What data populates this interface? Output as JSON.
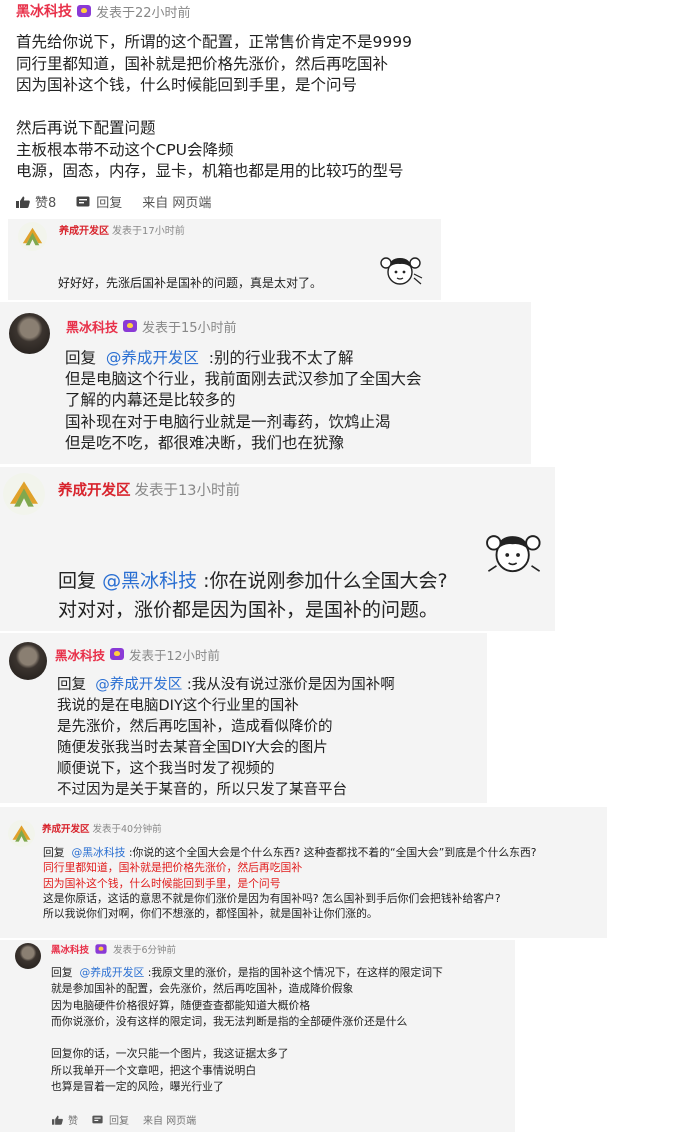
{
  "top_post": {
    "author": "黑冰科技",
    "time": "发表于22小时前",
    "lines": [
      "首先给你说下，所谓的这个配置，正常售价肯定不是9999",
      "同行里都知道，国补就是把价格先涨价，然后再吃国补",
      "因为国补这个钱，什么时候能回到手里，是个问号",
      "",
      "然后再说下配置问题",
      "主板根本带不动这个CPU会降频",
      "电源，固态，内存，显卡，机箱也都是用的比较巧的型号"
    ],
    "actions": {
      "like": "赞8",
      "reply": "回复",
      "source": "来自 网页端"
    }
  },
  "replies": [
    {
      "author": "养成开发区",
      "time": "发表于17小时前",
      "lines": [
        "好好好，先涨后国补是国补的问题，真是太对了。"
      ]
    },
    {
      "author": "黑冰科技",
      "time": "发表于15小时前",
      "reply_prefix": "回复",
      "mention": "@养成开发区",
      "first_rest": ":别的行业我不太了解",
      "lines": [
        "但是电脑这个行业，我前面刚去武汉参加了全国大会",
        "了解的内幕还是比较多的",
        "国补现在对于电脑行业就是一剂毒药，饮鸩止渴",
        "但是吃不吃，都很难决断，我们也在犹豫"
      ]
    },
    {
      "author": "养成开发区",
      "time": "发表于13小时前",
      "reply_prefix": "回复",
      "mention": "@黑冰科技",
      "first_rest": ":你在说刚参加什么全国大会?",
      "lines": [
        "对对对，涨价都是因为国补，是国补的问题。"
      ]
    },
    {
      "author": "黑冰科技",
      "time": "发表于12小时前",
      "reply_prefix": "回复",
      "mention": "@养成开发区",
      "first_rest": ":我从没有说过涨价是因为国补啊",
      "lines": [
        "我说的是在电脑DIY这个行业里的国补",
        "是先涨价，然后再吃国补，造成看似降价的",
        "随便发张我当时去某音全国DIY大会的图片",
        "顺便说下，这个我当时发了视频的",
        "不过因为是关于某音的，所以只发了某音平台"
      ]
    },
    {
      "author": "养成开发区",
      "time": "发表于40分钟前",
      "reply_prefix": "回复",
      "mention": "@黑冰科技",
      "first_rest": ":你说的这个全国大会是个什么东西? 这种查都找不着的“全国大会”到底是个什么东西?",
      "red_lines": [
        "同行里都知道，国补就是把价格先涨价，然后再吃国补",
        "因为国补这个钱，什么时候能回到手里，是个问号"
      ],
      "lines": [
        "这是你原话，这话的意思不就是你们涨价是因为有国补吗? 怎么国补到手后你们会把钱补给客户?",
        "所以我说你们对啊，你们不想涨的，都怪国补，就是国补让你们涨的。"
      ]
    },
    {
      "author": "黑冰科技",
      "time": "发表于6分钟前",
      "reply_prefix": "回复",
      "mention": "@养成开发区",
      "first_rest": ":我原文里的涨价，是指的国补这个情况下，在这样的限定词下",
      "lines": [
        "就是参加国补的配置，会先涨价，然后再吃国补，造成降价假象",
        "因为电脑硬件价格很好算，随便查查都能知道大概价格",
        "而你说涨价，没有这样的限定词，我无法判断是指的全部硬件涨价还是什么",
        "",
        "回复你的话，一次只能一个图片，我这证据太多了",
        "所以我单开一个文章吧，把这个事情说明白",
        "也算是冒着一定的风险，曝光行业了"
      ],
      "actions": {
        "like": "赞",
        "reply": "回复",
        "source": "来自 网页端"
      }
    }
  ],
  "colors": {
    "username": "#e8314a",
    "mention": "#2a6fd2",
    "quote_red": "#e11c1c",
    "card_bg": "#f4f4f4"
  },
  "icons": [
    "vip-badge-icon",
    "like-thumb-icon",
    "reply-bubble-icon",
    "cartoon-sticker"
  ]
}
